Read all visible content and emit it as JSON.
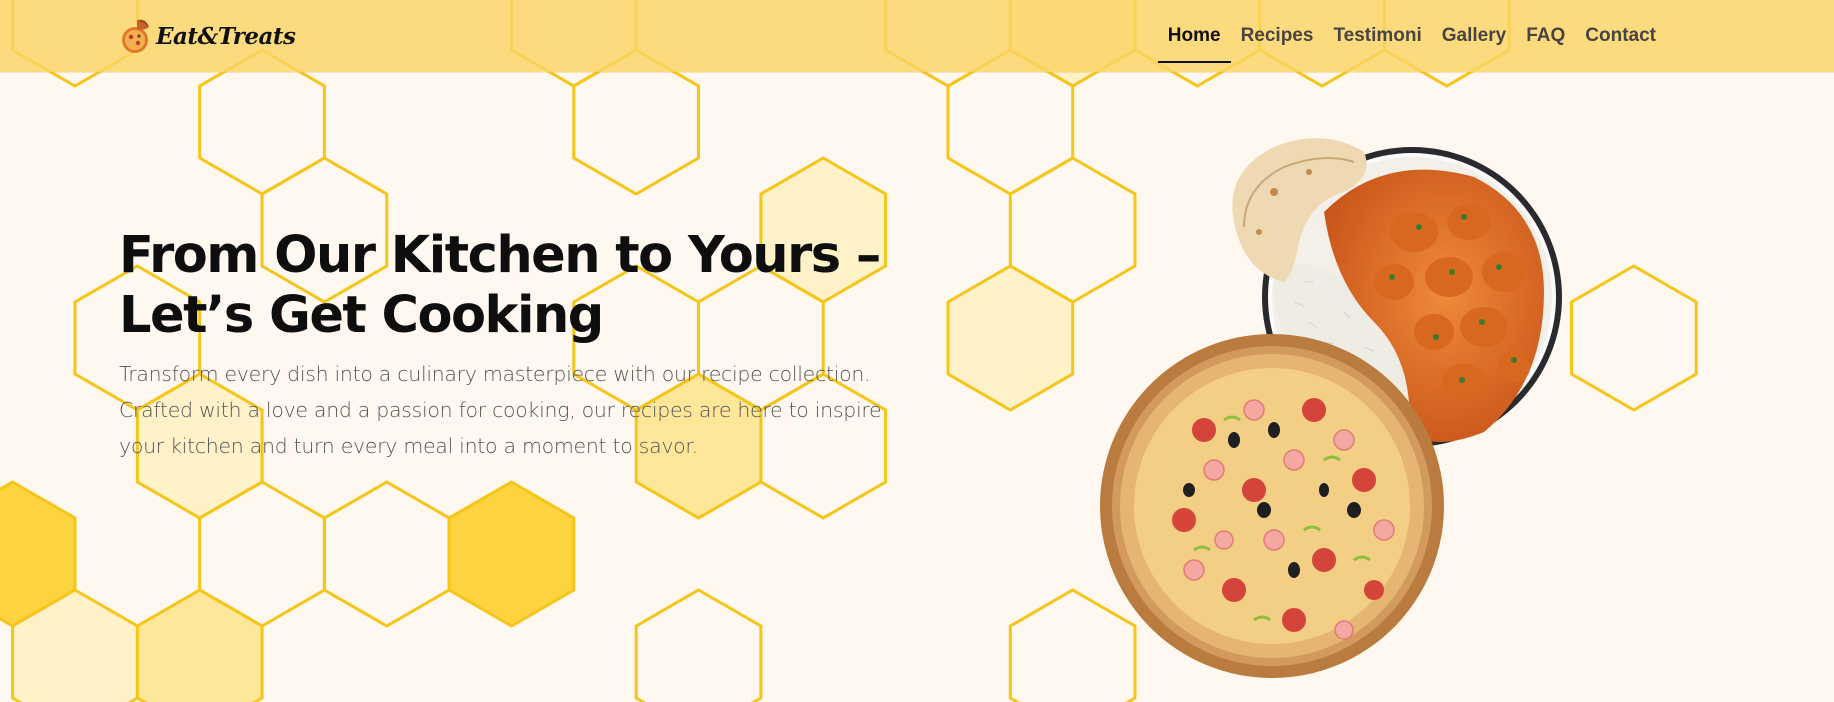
{
  "colors": {
    "page_background": "#fff8f1",
    "navbar_background": "#fad464",
    "hex_stroke": "#f5c518",
    "hex_fill_light": "#fff1c2",
    "hex_fill_mid": "#ffe48a",
    "hex_fill_strong": "#fdd235",
    "text_primary": "#0e0e0e",
    "text_secondary": "#555555"
  },
  "navbar": {
    "logo": {
      "text": "Eat&Treats",
      "icon": "food-logo-icon"
    },
    "links": [
      {
        "label": "Home",
        "active": true
      },
      {
        "label": "Recipes",
        "active": false
      },
      {
        "label": "Testimoni",
        "active": false
      },
      {
        "label": "Gallery",
        "active": false
      },
      {
        "label": "FAQ",
        "active": false
      },
      {
        "label": "Contact",
        "active": false
      }
    ]
  },
  "hero": {
    "title": "From Our Kitchen to Yours – Let’s Get Cooking",
    "subtitle": "Transform every dish into a culinary masterpiece with our recipe collection. Crafted with a love and a passion for cooking, our recipes are here to inspire your kitchen and turn every meal into a moment to savor.",
    "images": [
      {
        "name": "butter-chicken-rice-naan-image"
      },
      {
        "name": "pizza-on-wooden-board-image"
      }
    ]
  }
}
